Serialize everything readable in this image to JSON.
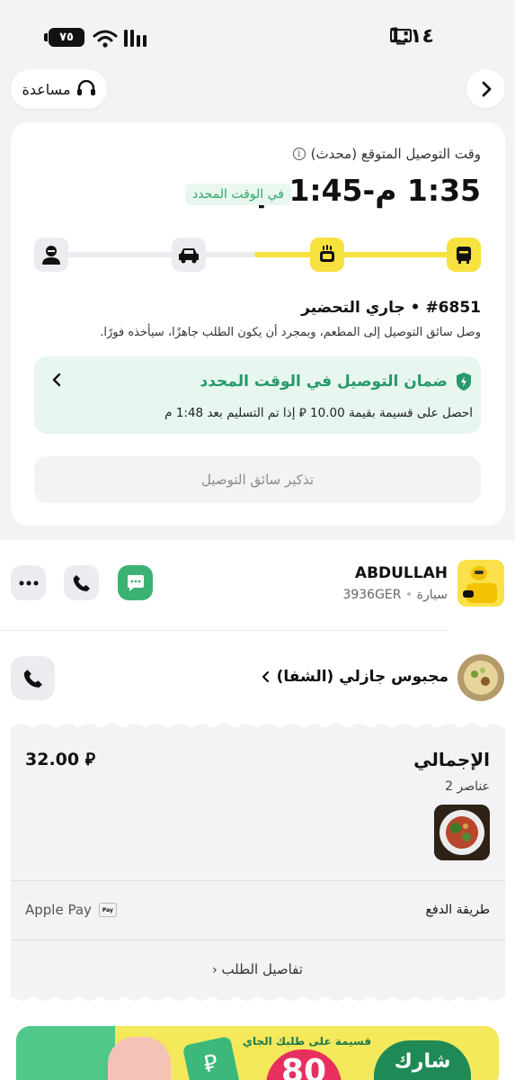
{
  "status_bar": {
    "time": "1:١٤",
    "battery": "٧٥"
  },
  "header": {
    "help_label": "مساعدة"
  },
  "eta": {
    "label": "وقت التوصيل المتوقع (محدث)",
    "time_range": "1:35 م-1:45 م",
    "badge": "في الوقت المحدد"
  },
  "order": {
    "status": "#6851 • جاري التحضير",
    "description": "وصل سائق التوصيل إلى المطعم، وبمجرد أن يكون الطلب جاهزًا، سيأخذه فورًا."
  },
  "guarantee": {
    "title": "ضمان التوصيل في الوقت المحدد",
    "description": "احصل على قسيمة بقيمة 10.00 ⃁ إذا تم التسليم بعد 1:48 م"
  },
  "remind_button": "تذكير سائق التوصيل",
  "driver": {
    "name": "ABDULLAH",
    "vehicle": "سيارة",
    "plate": "3936GER"
  },
  "restaurant": {
    "name": "مجبوس جازلي (الشفا)"
  },
  "receipt": {
    "total_label": "الإجمالي",
    "total_value": "32.00 ⃁",
    "items_count": "عناصر 2",
    "payment_label": "طريقة الدفع",
    "payment_value": "Apple Pay",
    "applepay_badge": "Pay",
    "details_link": "تفاصيل الطلب"
  },
  "promo": {
    "text": "قسيمة على طلبك الجاي",
    "number": "80",
    "share": "شارك"
  },
  "colors": {
    "accent_yellow": "#f7e13f",
    "green": "#3bb273",
    "guarantee_green": "#26996a"
  }
}
